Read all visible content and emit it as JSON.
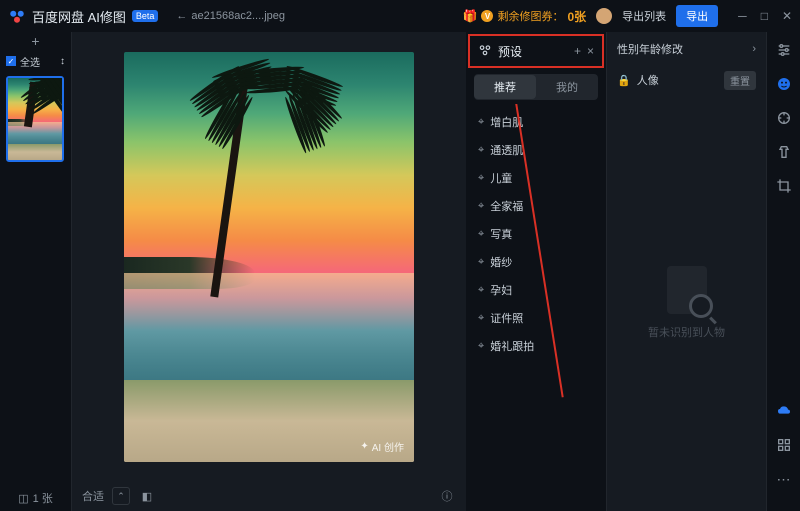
{
  "titlebar": {
    "app_name": "百度网盘 AI修图",
    "beta_label": "Beta",
    "filename": "ae21568ac2....jpeg",
    "coupon_label": "剩余修图券：",
    "coupon_count": "0张",
    "export_list": "导出列表",
    "export": "导出"
  },
  "thumbs": {
    "select_all": "全选",
    "count_label": "1 张"
  },
  "canvas": {
    "fit_label": "合适",
    "watermark": "AI 创作"
  },
  "presets": {
    "header": "预设",
    "tabs": {
      "recommend": "推荐",
      "mine": "我的"
    },
    "items": [
      {
        "label": "增白肌"
      },
      {
        "label": "通透肌"
      },
      {
        "label": "儿童"
      },
      {
        "label": "全家福"
      },
      {
        "label": "写真"
      },
      {
        "label": "婚纱"
      },
      {
        "label": "孕妇"
      },
      {
        "label": "证件照"
      },
      {
        "label": "婚礼跟拍"
      }
    ]
  },
  "adjust": {
    "gender_age": "性别年龄修改",
    "portrait": "人像",
    "reset": "重置",
    "empty": "暂未识别到人物"
  }
}
